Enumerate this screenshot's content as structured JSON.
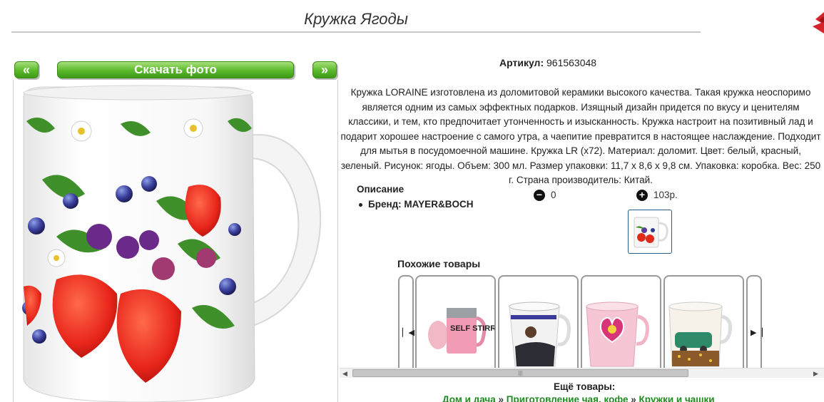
{
  "header": {
    "title": "Кружка Ягоды"
  },
  "nav": {
    "prev_label": "«",
    "download_label": "Скачать фото",
    "next_label": "»"
  },
  "product": {
    "article_label": "Артикул:",
    "article_value": "961563048",
    "description": "Кружка LORAINE изготовлена из доломитовой керамики высокого качества. Такая кружка неоспоримо является одним из самых эффектных подарков. Изящный дизайн придется по вкусу и ценителям классики, и тем, кто предпочитает утонченность и изысканность. Кружка настроит на позитивный лад и подарит хорошее настроение с самого утра, а чаепитие превратится в настоящее наслаждение. Подходит для мытья в посудомоечной машине. Кружка LR (х72). Материал: доломит. Цвет: белый, красный, зеленый. Рисунок: ягоды. Объем: 300 мл. Размер упаковки: 11,7 х 8,6 х 9,8 см. Упаковка: коробка. Вес: 250 г. Страна производитель: Китай.",
    "description_heading": "Описание",
    "brand_label": "Бренд: MAYER&BOCH"
  },
  "votes": {
    "minus_count": "0",
    "plus_value": "103р."
  },
  "similar": {
    "heading": "Похожие товары",
    "items": [
      {
        "label": "SELF STIRRING MUG"
      },
      {
        "label": ""
      },
      {
        "label": ""
      },
      {
        "label": ""
      }
    ]
  },
  "more": {
    "heading": "Ещё товары:",
    "crumbs": [
      "Дом и дача",
      "Приготовление чая, кофе",
      "Кружки и чашки"
    ],
    "sep": "»"
  },
  "colors": {
    "accent_green": "#4fb021",
    "link_green": "#1f8a20",
    "close_red": "#d4232a"
  }
}
